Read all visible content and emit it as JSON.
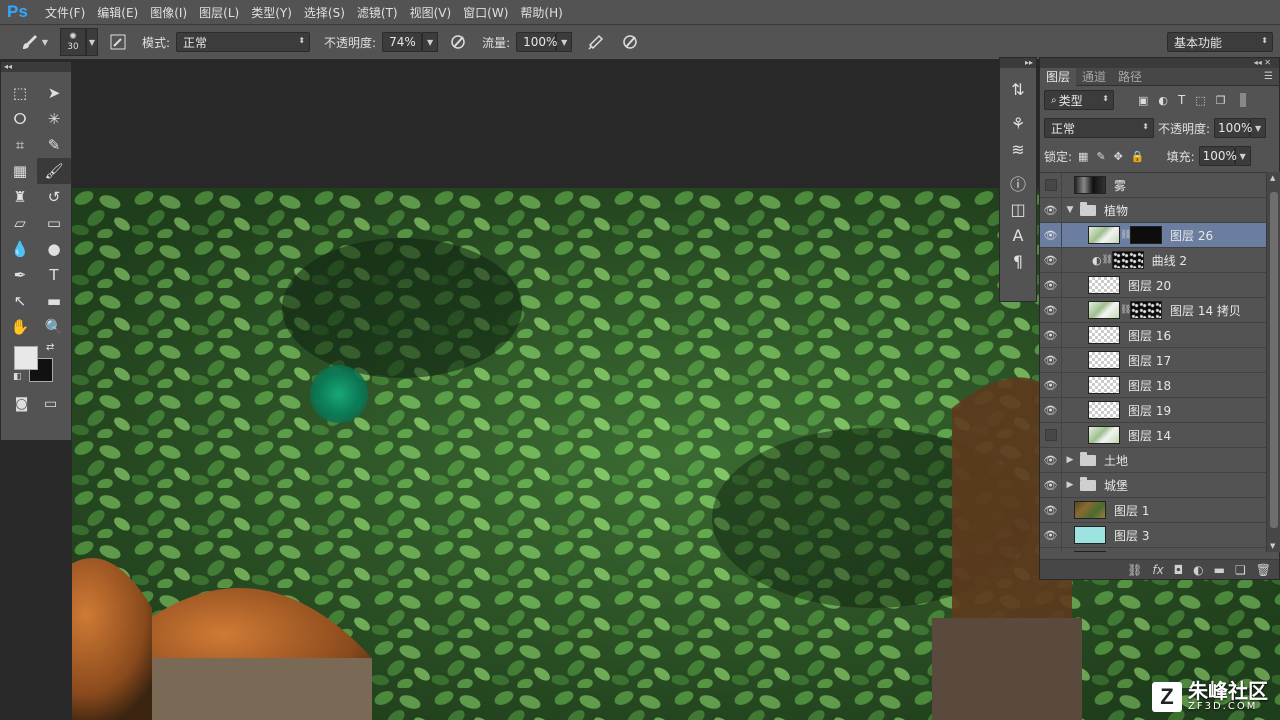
{
  "app": {
    "logo": "Ps",
    "menus": [
      "文件(F)",
      "编辑(E)",
      "图像(I)",
      "图层(L)",
      "类型(Y)",
      "选择(S)",
      "滤镜(T)",
      "视图(V)",
      "窗口(W)",
      "帮助(H)"
    ]
  },
  "options": {
    "brush_size": "30",
    "mode_label": "模式:",
    "mode_value": "正常",
    "opacity_label": "不透明度:",
    "opacity_value": "74%",
    "flow_label": "流量:",
    "flow_value": "100%",
    "workspace": "基本功能"
  },
  "layers_panel": {
    "tabs": [
      "图层",
      "通道",
      "路径"
    ],
    "filter_label": "类型",
    "blend_mode": "正常",
    "opacity_label": "不透明度:",
    "opacity_value": "100%",
    "lock_label": "锁定:",
    "fill_label": "填充:",
    "fill_value": "100%",
    "layers": [
      {
        "name": "雾",
        "visible": false,
        "kind": "layer"
      },
      {
        "name": "植物",
        "visible": true,
        "kind": "group-open"
      },
      {
        "name": "图层 26",
        "visible": true,
        "kind": "layer-mask",
        "selected": true
      },
      {
        "name": "曲线 2",
        "visible": true,
        "kind": "adjustment"
      },
      {
        "name": "图层 20",
        "visible": true,
        "kind": "layer"
      },
      {
        "name": "图层 14 拷贝",
        "visible": true,
        "kind": "layer-mask"
      },
      {
        "name": "图层 16",
        "visible": true,
        "kind": "layer"
      },
      {
        "name": "图层 17",
        "visible": true,
        "kind": "layer"
      },
      {
        "name": "图层 18",
        "visible": true,
        "kind": "layer"
      },
      {
        "name": "图层 19",
        "visible": true,
        "kind": "layer"
      },
      {
        "name": "图层 14",
        "visible": false,
        "kind": "layer"
      },
      {
        "name": "土地",
        "visible": true,
        "kind": "group"
      },
      {
        "name": "城堡",
        "visible": true,
        "kind": "group"
      },
      {
        "name": "图层 1",
        "visible": true,
        "kind": "layer"
      },
      {
        "name": "图层 3",
        "visible": true,
        "kind": "layer"
      }
    ]
  },
  "watermark": {
    "mark": "Z",
    "name": "朱峰社区",
    "site": "ZF3D.COM"
  }
}
